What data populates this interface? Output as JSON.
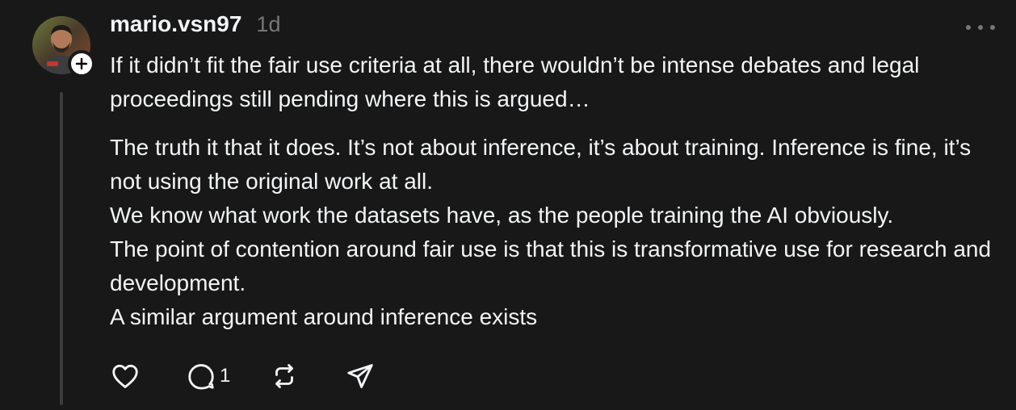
{
  "post": {
    "username": "mario.vsn97",
    "timestamp": "1d",
    "paragraph_1": "If it didn’t fit the fair use criteria at all, there wouldn’t be intense debates and legal proceedings still pending where this is argued…",
    "paragraph_2_lines": [
      "The truth it that it does. It’s not about inference, it’s about training. Inference is fine, it’s not using the original work at all.",
      "We know what work the datasets have, as the people training the AI obviously.",
      "The point of contention around fair use is that this is transformative use for research and development.",
      "A similar argument around inference exists"
    ],
    "reply_count": "1"
  },
  "icons": {
    "like": "heart-icon",
    "reply": "comment-icon",
    "repost": "repost-icon",
    "share": "send-icon",
    "more": "more-dots-icon",
    "follow": "plus-icon"
  },
  "colors": {
    "background": "#181818",
    "text": "#f3f5f7",
    "muted": "#777777",
    "thread_line": "#3c3c3c"
  }
}
